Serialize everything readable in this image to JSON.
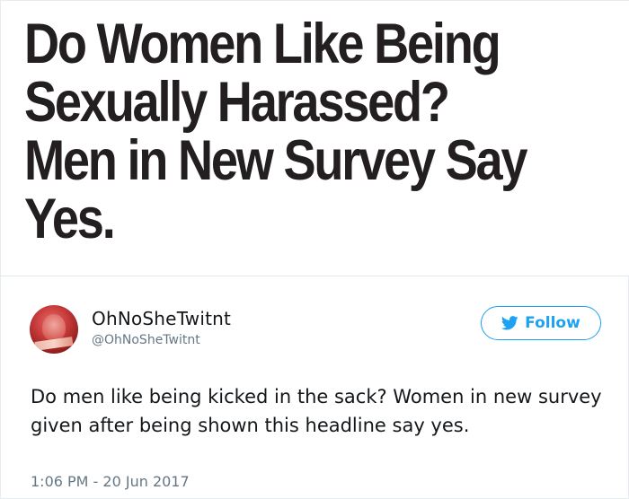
{
  "headline": {
    "lines": [
      "Do Women Like Being",
      "Sexually Harassed?",
      "Men in New Survey Say",
      "Yes."
    ]
  },
  "tweet": {
    "display_name": "OhNoSheTwitnt",
    "handle": "@OhNoSheTwitnt",
    "follow_label": "Follow",
    "text": "Do men like being kicked in the sack? Women in new survey given after being shown this headline say yes.",
    "timestamp": "1:06 PM - 20 Jun 2017"
  },
  "colors": {
    "accent": "#1da1f2",
    "headline": "#231f20",
    "muted": "#657786"
  },
  "icons": {
    "follow": "bird-icon",
    "avatar": "avatar"
  }
}
